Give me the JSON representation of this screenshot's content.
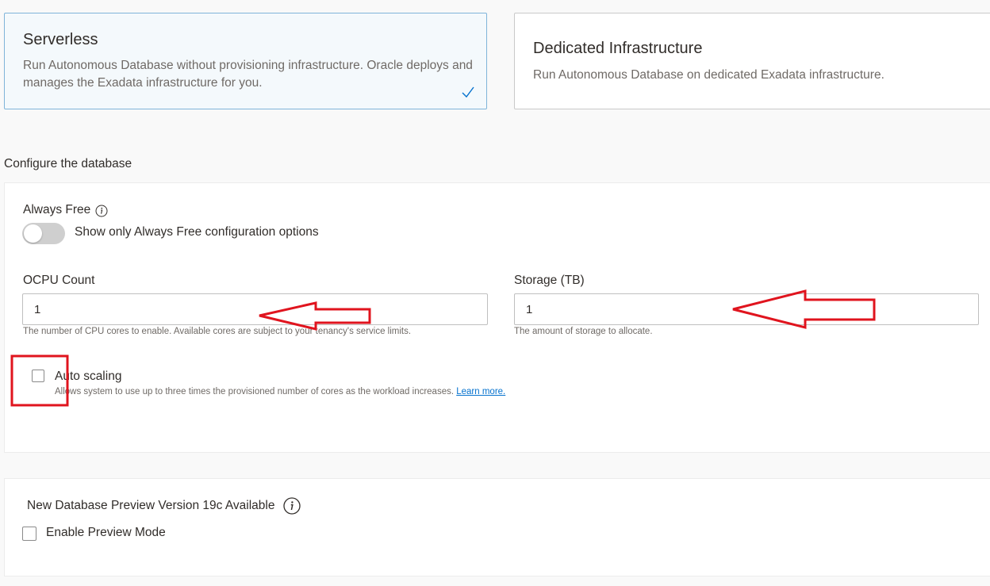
{
  "deployment": {
    "serverless": {
      "title": "Serverless",
      "description": "Run Autonomous Database without provisioning infrastructure. Oracle deploys and manages the Exadata infrastructure for you.",
      "selected": true
    },
    "dedicated": {
      "title": "Dedicated Infrastructure",
      "description": "Run Autonomous Database on dedicated Exadata infrastructure.",
      "selected": false
    }
  },
  "configure": {
    "section_label": "Configure the database",
    "always_free": {
      "label": "Always Free",
      "toggle_label": "Show only Always Free configuration options",
      "enabled": false
    },
    "ocpu": {
      "label": "OCPU Count",
      "value": "1",
      "helper": "The number of CPU cores to enable. Available cores are subject to your tenancy's service limits."
    },
    "storage": {
      "label": "Storage (TB)",
      "value": "1",
      "helper": "The amount of storage to allocate."
    },
    "auto_scaling": {
      "label": "Auto scaling",
      "helper": "Allows system to use up to three times the provisioned number of cores as the workload increases.",
      "learn_more": "Learn more.",
      "checked": false
    }
  },
  "preview": {
    "title": "New Database Preview Version 19c Available",
    "checkbox_label": "Enable Preview Mode",
    "checked": false
  },
  "colors": {
    "accent": "#0572ce",
    "selected_border": "#7fb4d9",
    "annotation": "#e0141e"
  }
}
